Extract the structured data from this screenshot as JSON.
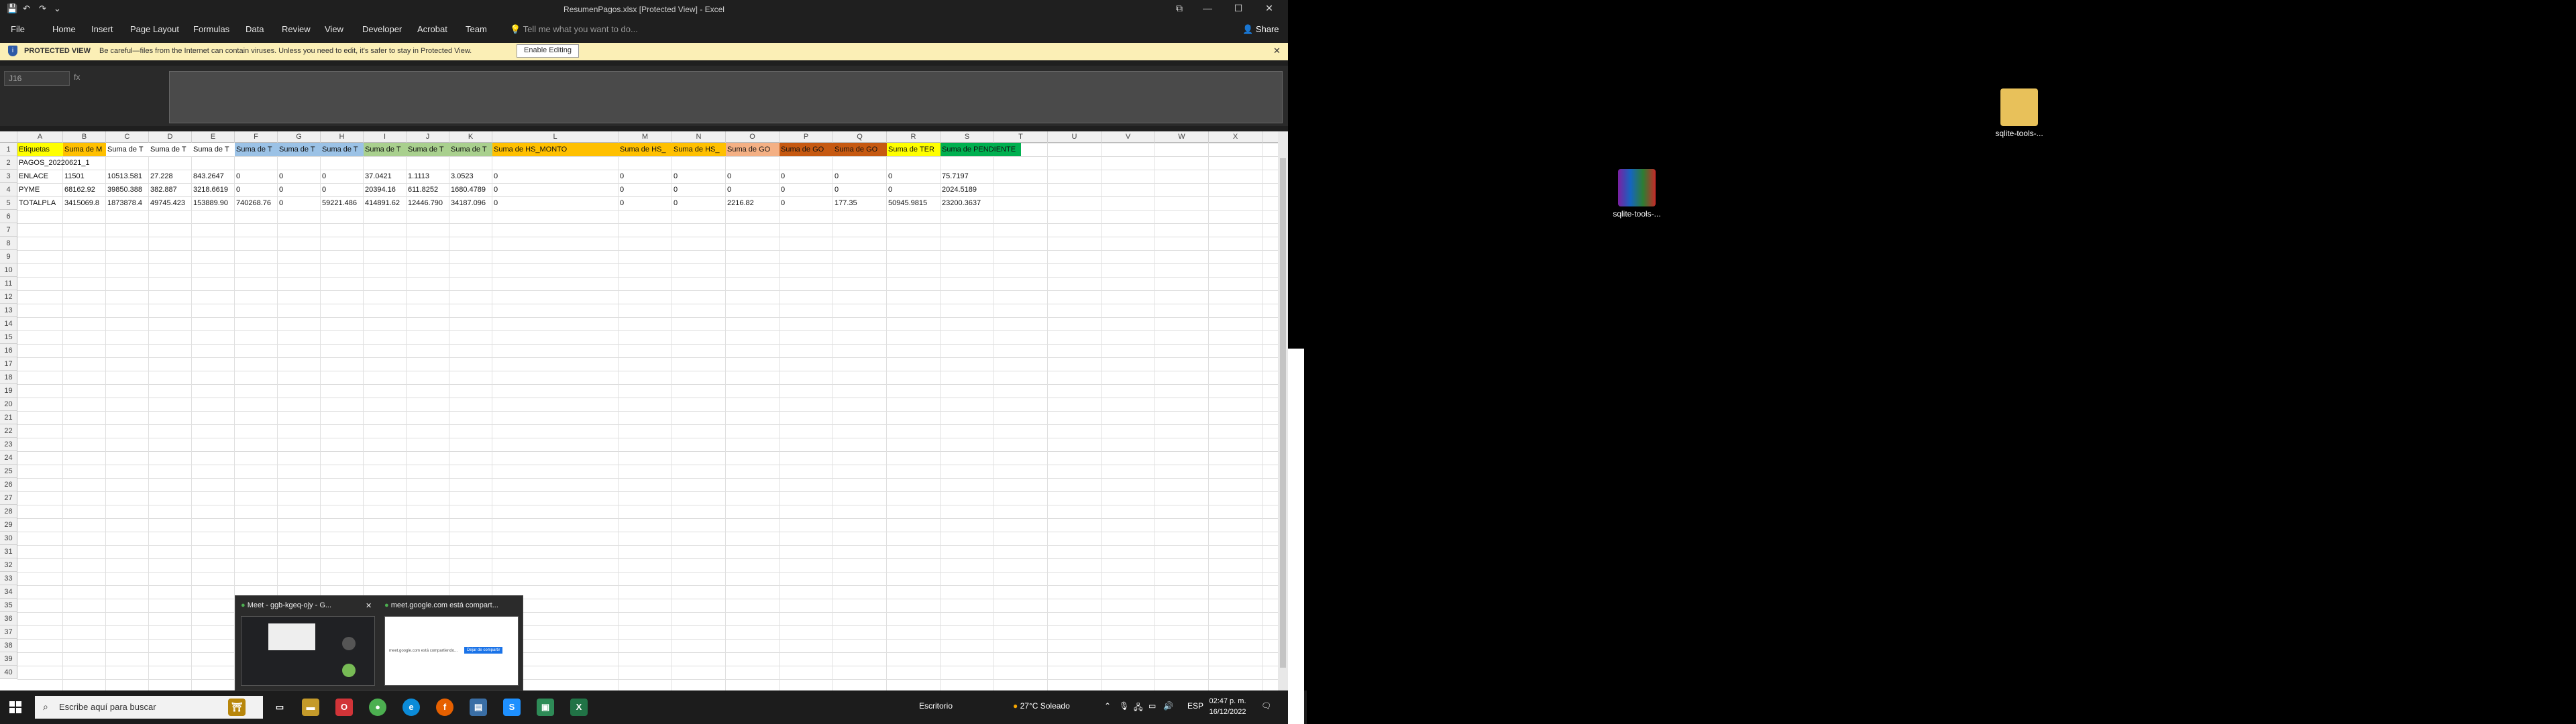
{
  "window": {
    "title": "ResumenPagos.xlsx  [Protected View] - Excel",
    "controls": {
      "restore": "⧉",
      "minimize": "—",
      "maximize": "☐",
      "close": "✕"
    }
  },
  "menu": {
    "items": [
      "File",
      "Home",
      "Insert",
      "Page Layout",
      "Formulas",
      "Data",
      "Review",
      "View",
      "Developer",
      "Acrobat",
      "Team"
    ],
    "tell_me": "Tell me what you want to do...",
    "share": "Share"
  },
  "protected_view": {
    "title": "PROTECTED VIEW",
    "message": "Be careful—files from the Internet can contain viruses. Unless you need to edit, it's safer to stay in Protected View.",
    "enable_button": "Enable Editing",
    "close": "✕"
  },
  "formula_bar": {
    "name_box": "J16",
    "fx": "fx"
  },
  "sheet": {
    "columns": [
      "A",
      "B",
      "C",
      "D",
      "E",
      "F",
      "G",
      "H",
      "I",
      "J",
      "K",
      "L",
      "M",
      "N",
      "O",
      "P",
      "Q",
      "R",
      "S",
      "T",
      "U",
      "V",
      "W",
      "X"
    ],
    "row_count": 40,
    "rows": [
      [
        "Etiquetas",
        "Suma de M",
        "Suma de T",
        "Suma de T",
        "Suma de T",
        "Suma de T",
        "Suma de T",
        "Suma de T",
        "Suma de T",
        "Suma de T",
        "Suma de T",
        "Suma de HS_MONTO",
        "Suma de HS_",
        "Suma de HS_",
        "Suma de GO",
        "Suma de GO",
        "Suma de GO",
        "Suma de TER",
        "Suma de PENDIENTE"
      ],
      [
        "PAGOS_20220621_1",
        "",
        "",
        "",
        "",
        "",
        "",
        "",
        "",
        "",
        "",
        "",
        "",
        "",
        "",
        "",
        "",
        "",
        ""
      ],
      [
        "ENLACE",
        "11501",
        "10513.581",
        "27.228",
        "843.2647",
        "0",
        "0",
        "0",
        "37.0421",
        "1.1113",
        "3.0523",
        "0",
        "0",
        "0",
        "0",
        "0",
        "0",
        "0",
        "75.7197"
      ],
      [
        "PYME",
        "68162.92",
        "39850.388",
        "382.887",
        "3218.6619",
        "0",
        "0",
        "0",
        "20394.16",
        "611.8252",
        "1680.4789",
        "0",
        "0",
        "0",
        "0",
        "0",
        "0",
        "0",
        "2024.5189"
      ],
      [
        "TOTALPLA",
        "3415069.8",
        "1873878.4",
        "49745.423",
        "153889.90",
        "740268.76",
        "0",
        "59221.486",
        "414891.62",
        "12446.790",
        "34187.096",
        "0",
        "0",
        "0",
        "2216.82",
        "0",
        "177.35",
        "50945.9815",
        "23200.3637"
      ]
    ],
    "header_colors": [
      "#ffff00",
      "#ffc000",
      "#ffffff",
      "#ffffff",
      "#ffffff",
      "#9bc2e6",
      "#9bc2e6",
      "#9bc2e6",
      "#a9d08e",
      "#a9d08e",
      "#a9d08e",
      "#ffc000",
      "#ffc000",
      "#ffc000",
      "#f4b084",
      "#c65911",
      "#c65911",
      "#ffff00",
      "#00b050"
    ]
  },
  "preview": {
    "window1": "Meet - ggb-kgeq-ojy - G...",
    "window2": "meet.google.com está compart...",
    "close": "✕",
    "thumb2_button": "Dejar de compartir",
    "thumb2_text": "meet.google.com está compartiendo..."
  },
  "taskbar": {
    "search_placeholder": "Escribe aquí para buscar",
    "desktop_label": "Escritorio",
    "weather": "27°C  Soleado",
    "lang": "ESP",
    "time": "02:47 p. m.",
    "date": "16/12/2022"
  },
  "desktop": {
    "icon1": "sqlite-tools-...",
    "icon2": "sqlite-tools-..."
  },
  "colors": {
    "accent_green": "#217346",
    "protected_bg": "#fbefb6"
  }
}
